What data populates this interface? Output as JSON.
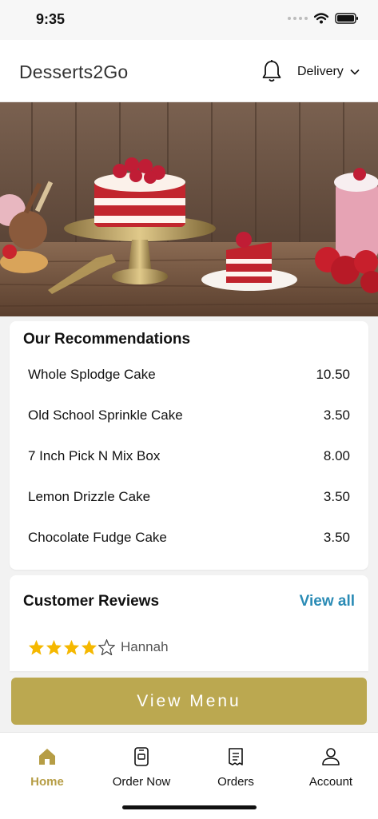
{
  "status_bar": {
    "time": "9:35"
  },
  "header": {
    "title": "Desserts2Go",
    "delivery_label": "Delivery",
    "bell_icon": "bell-icon"
  },
  "recommendations": {
    "title": "Our Recommendations",
    "items": [
      {
        "name": "Whole Splodge Cake",
        "price": "10.50"
      },
      {
        "name": "Old School Sprinkle Cake",
        "price": "3.50"
      },
      {
        "name": "7 Inch Pick N Mix Box",
        "price": "8.00"
      },
      {
        "name": "Lemon Drizzle Cake",
        "price": "3.50"
      },
      {
        "name": "Chocolate Fudge Cake",
        "price": "3.50"
      }
    ]
  },
  "reviews": {
    "title": "Customer Reviews",
    "view_all": "View all",
    "items": [
      {
        "reviewer": "Hannah",
        "rating": 4,
        "max_rating": 5
      }
    ]
  },
  "view_menu_label": "View Menu",
  "tabs": [
    {
      "label": "Home",
      "icon": "home-icon",
      "active": true
    },
    {
      "label": "Order Now",
      "icon": "phone-order-icon",
      "active": false
    },
    {
      "label": "Orders",
      "icon": "receipt-icon",
      "active": false
    },
    {
      "label": "Account",
      "icon": "user-icon",
      "active": false
    }
  ],
  "colors": {
    "accent": "#bba850",
    "link": "#2a8bb5",
    "active_tab": "#b69d45",
    "star": "#f5b800"
  }
}
